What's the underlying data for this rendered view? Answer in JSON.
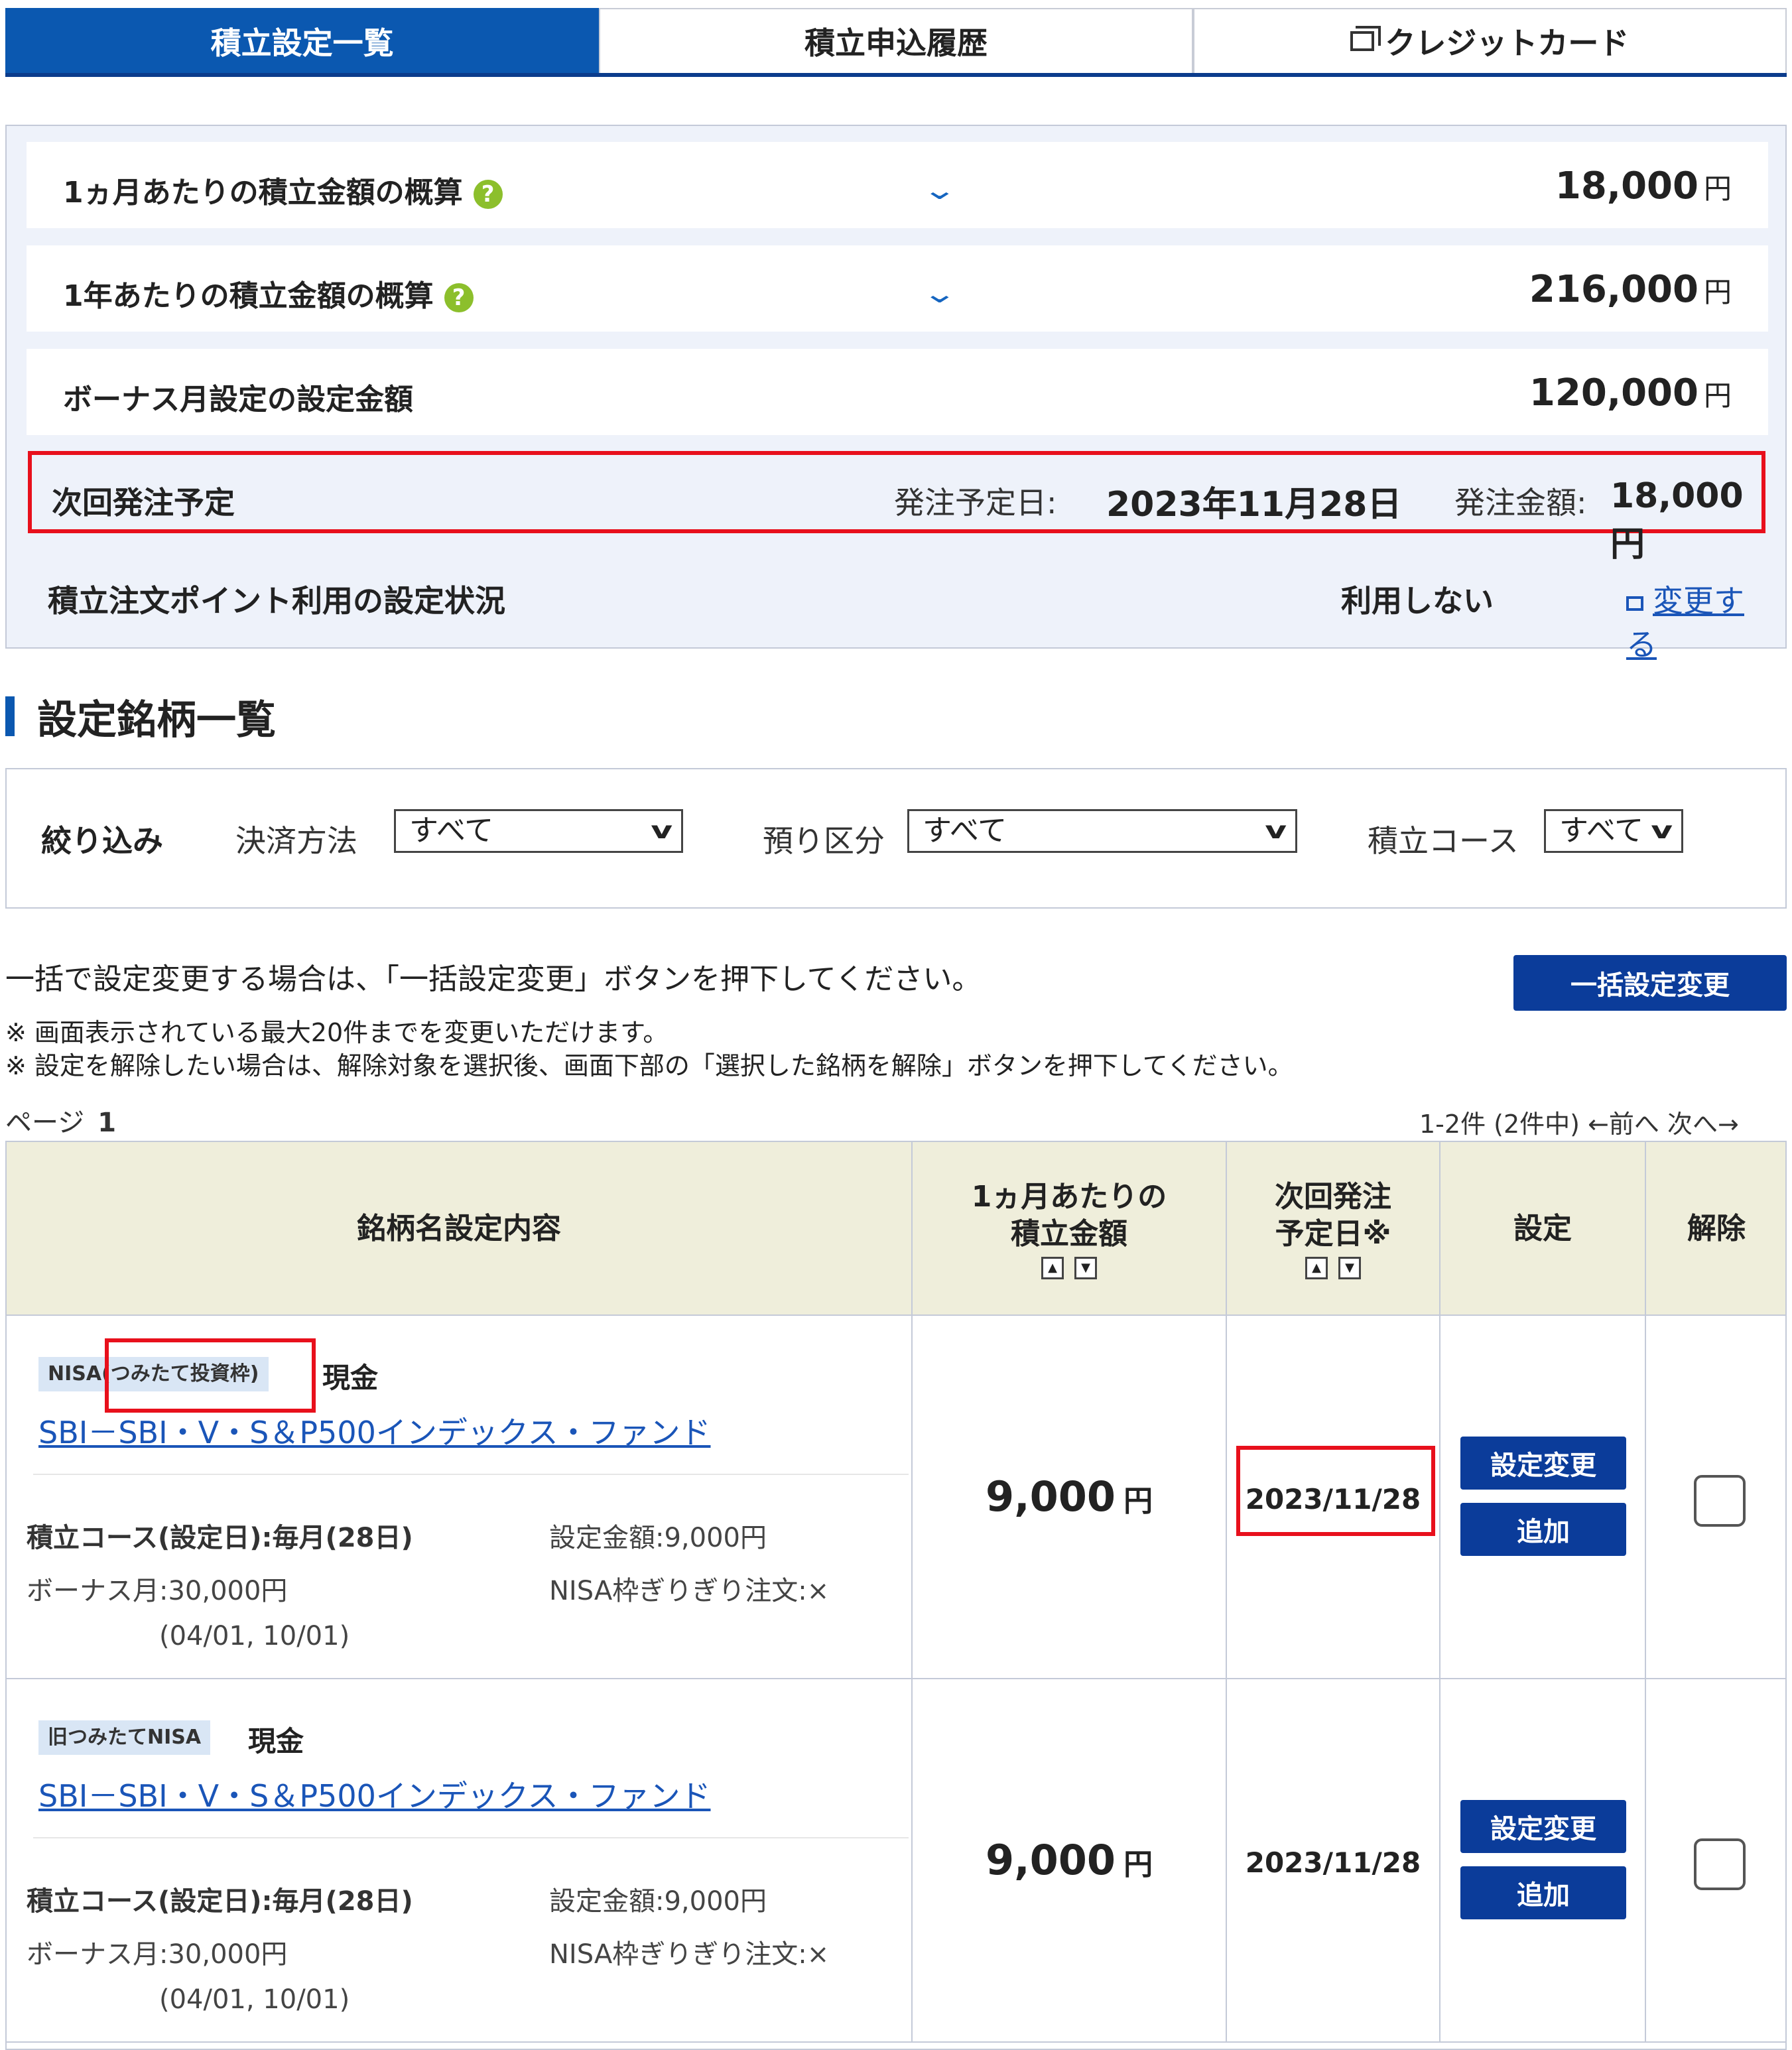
{
  "tabs": [
    {
      "label": "積立設定一覧",
      "active": true
    },
    {
      "label": "積立申込履歴",
      "active": false
    },
    {
      "label": "クレジットカード",
      "active": false
    }
  ],
  "summary": {
    "monthly_label": "1ヵ月あたりの積立金額の概算",
    "monthly_value": "18,000",
    "yearly_label": "1年あたりの積立金額の概算",
    "yearly_value": "216,000",
    "bonus_label": "ボーナス月設定の設定金額",
    "bonus_value": "120,000",
    "unit": "円",
    "help_glyph": "?",
    "expand_glyph": "⌄"
  },
  "next_order": {
    "label": "次回発注予定",
    "date_label": "発注予定日:",
    "date_value": "2023年11月28日",
    "amount_label": "発注金額:",
    "amount_value": "18,000 円"
  },
  "points": {
    "label": "積立注文ポイント利用の設定状況",
    "status": "利用しない",
    "change_link": "変更する"
  },
  "section": {
    "title": "設定銘柄一覧"
  },
  "filter": {
    "title": "絞り込み",
    "payment_label": "決済方法",
    "payment_value": "すべて",
    "account_label": "預り区分",
    "account_value": "すべて",
    "course_label": "積立コース",
    "course_value": "すべて"
  },
  "bulk": {
    "note": "一括で設定変更する場合は、「一括設定変更」ボタンを押下してください。",
    "button": "一括設定変更",
    "note1": "※ 画面表示されている最大20件までを変更いただけます。",
    "note2": "※ 設定を解除したい場合は、解除対象を選択後、画面下部の「選択した銘柄を解除」ボタンを押下してください。"
  },
  "pagination": {
    "page_label": "ページ",
    "page_number": "1",
    "range": "1-2件 (2件中) ←前へ 次へ→"
  },
  "table": {
    "headers": {
      "name": "銘柄名設定内容",
      "amount_l1": "1ヵ月あたりの",
      "amount_l2": "積立金額",
      "date_l1": "次回発注",
      "date_l2": "予定日※",
      "setting": "設定",
      "cancel": "解除"
    },
    "sort_up": "▲",
    "sort_down": "▼",
    "rows": [
      {
        "tag": "NISA(つみたて投資枠)",
        "payment": "現金",
        "fund": "SBI－SBI・V・S＆P500インデックス・ファンド",
        "course": "積立コース(設定日):毎月(28日)",
        "setting_amount": "設定金額:9,000円",
        "bonus": "ボーナス月:30,000円",
        "nisa_order": "NISA枠ぎりぎり注文:×",
        "bonus_dates": "(04/01, 10/01)",
        "amount": "9,000",
        "unit": "円",
        "next_date": "2023/11/28",
        "btn_change": "設定変更",
        "btn_add": "追加"
      },
      {
        "tag": "旧つみたてNISA",
        "payment": "現金",
        "fund": "SBI－SBI・V・S＆P500インデックス・ファンド",
        "course": "積立コース(設定日):毎月(28日)",
        "setting_amount": "設定金額:9,000円",
        "bonus": "ボーナス月:30,000円",
        "nisa_order": "NISA枠ぎりぎり注文:×",
        "bonus_dates": "(04/01, 10/01)",
        "amount": "9,000",
        "unit": "円",
        "next_date": "2023/11/28",
        "btn_change": "設定変更",
        "btn_add": "追加"
      }
    ]
  },
  "colors": {
    "accent": "#0b58b0",
    "button": "#0b3c9a",
    "highlight": "#e8101c",
    "help": "#8cbf2c",
    "header_bg": "#efeedb"
  }
}
